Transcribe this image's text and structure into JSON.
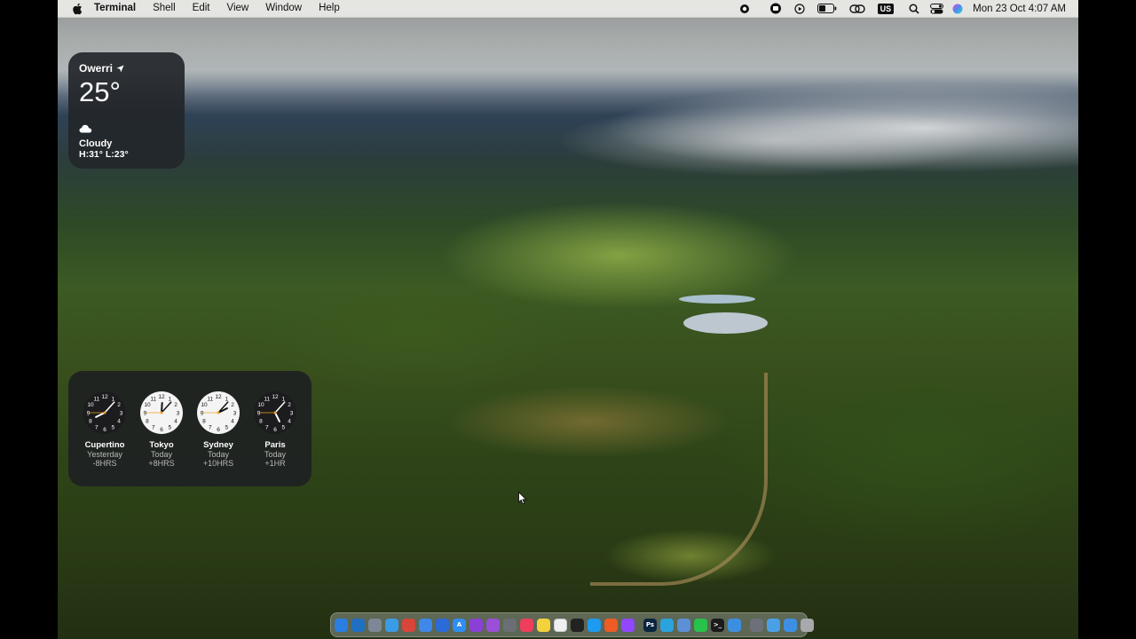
{
  "menubar": {
    "app_name": "Terminal",
    "menus": [
      "Shell",
      "Edit",
      "View",
      "Window",
      "Help"
    ],
    "input_source": "US",
    "datetime": "Mon 23 Oct  4:07 AM",
    "status_icons": [
      "record-icon",
      "tunnel-icon",
      "play-icon",
      "battery-icon",
      "link-icon",
      "input-source-icon",
      "search-icon",
      "control-center-icon",
      "siri-icon"
    ]
  },
  "weather": {
    "city": "Owerri",
    "temperature": "25°",
    "condition": "Cloudy",
    "high_low": "H:31° L:23°",
    "condition_icon": "cloud-icon",
    "location_icon": "location-arrow-icon"
  },
  "world_clock": [
    {
      "city": "Cupertino",
      "day": "Yesterday",
      "offset": "-8HRS",
      "time": "20:07",
      "face": "dark"
    },
    {
      "city": "Tokyo",
      "day": "Today",
      "offset": "+8HRS",
      "time": "12:07",
      "face": "light"
    },
    {
      "city": "Sydney",
      "day": "Today",
      "offset": "+10HRS",
      "time": "14:07",
      "face": "light"
    },
    {
      "city": "Paris",
      "day": "Today",
      "offset": "+1HR",
      "time": "05:07",
      "face": "dark"
    }
  ],
  "dock": {
    "apps": [
      {
        "name": "finder-icon",
        "color": "#2a7de1",
        "glyph": ""
      },
      {
        "name": "vscode-icon",
        "color": "#1f6fc2",
        "glyph": ""
      },
      {
        "name": "launchpad-icon",
        "color": "#7d8797",
        "glyph": ""
      },
      {
        "name": "safari-icon",
        "color": "#3a9be6",
        "glyph": ""
      },
      {
        "name": "chrome-icon",
        "color": "#d8453a",
        "glyph": ""
      },
      {
        "name": "mail-icon",
        "color": "#3d88e8",
        "glyph": ""
      },
      {
        "name": "xcode-icon",
        "color": "#2a6bd8",
        "glyph": ""
      },
      {
        "name": "appstore-icon",
        "color": "#2f8ef0",
        "glyph": "A"
      },
      {
        "name": "intellij-icon",
        "color": "#8b3fd6",
        "glyph": ""
      },
      {
        "name": "podcasts-icon",
        "color": "#9a4fd8",
        "glyph": ""
      },
      {
        "name": "settings-icon",
        "color": "#6b6f75",
        "glyph": ""
      },
      {
        "name": "music-icon",
        "color": "#ef3e5c",
        "glyph": ""
      },
      {
        "name": "notes-icon",
        "color": "#f4d23c",
        "glyph": ""
      },
      {
        "name": "reminders-icon",
        "color": "#f0f0f0",
        "glyph": ""
      },
      {
        "name": "github-icon",
        "color": "#222222",
        "glyph": ""
      },
      {
        "name": "twitter-icon",
        "color": "#1d9bf0",
        "glyph": ""
      },
      {
        "name": "postman-icon",
        "color": "#ef5b25",
        "glyph": ""
      },
      {
        "name": "twitch-icon",
        "color": "#9146ff",
        "glyph": ""
      }
    ],
    "apps2": [
      {
        "name": "photoshop-icon",
        "color": "#0a2540",
        "glyph": "Ps"
      },
      {
        "name": "telegram-icon",
        "color": "#2aa3df",
        "glyph": ""
      },
      {
        "name": "preview-icon",
        "color": "#5c8fd6",
        "glyph": ""
      },
      {
        "name": "whatsapp-icon",
        "color": "#27c24c",
        "glyph": ""
      },
      {
        "name": "terminal-icon",
        "color": "#1b1b1b",
        "glyph": ">_"
      },
      {
        "name": "cloud-drive-icon",
        "color": "#3c8fe0",
        "glyph": ""
      }
    ],
    "apps3": [
      {
        "name": "screen-capture-icon",
        "color": "#6d7078",
        "glyph": ""
      },
      {
        "name": "folder-icon",
        "color": "#4aa0e6",
        "glyph": ""
      },
      {
        "name": "downloads-icon",
        "color": "#3d8fe4",
        "glyph": ""
      },
      {
        "name": "trash-icon",
        "color": "#a7a9ad",
        "glyph": ""
      }
    ]
  }
}
